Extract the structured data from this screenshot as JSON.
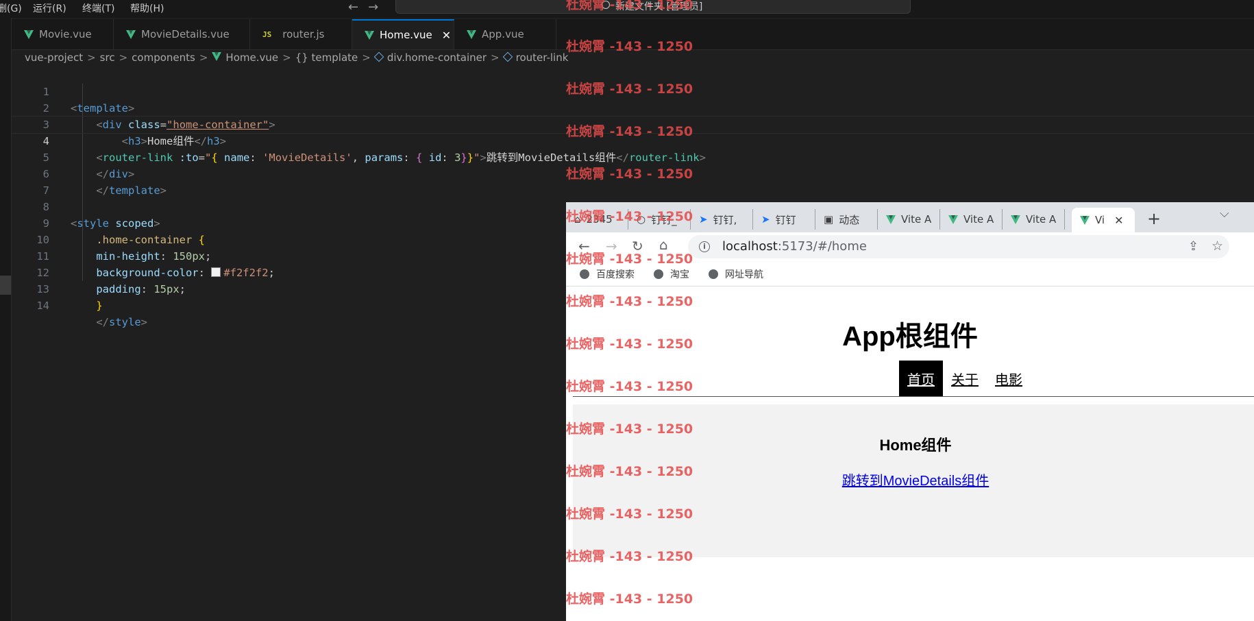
{
  "menubar": {
    "items": [
      "删(G)",
      "运行(R)",
      "终端(T)",
      "帮助(H)"
    ],
    "nav_back": "←",
    "nav_forward": "→",
    "command_center": "新建文件夹 [管理员]"
  },
  "tabs": [
    {
      "label": "Movie.vue",
      "icon": "vue-icon"
    },
    {
      "label": "MovieDetails.vue",
      "icon": "vue-icon"
    },
    {
      "label": "router.js",
      "icon": "js-icon"
    },
    {
      "label": "Home.vue",
      "icon": "vue-icon",
      "active": true
    },
    {
      "label": "App.vue",
      "icon": "vue-icon"
    }
  ],
  "tab_close": "✕",
  "js_badge": "JS",
  "breadcrumb": [
    "vue-project",
    "src",
    "components",
    "Home.vue",
    "{} template",
    "div.home-container",
    "router-link"
  ],
  "breadcrumb_sep": ">",
  "line_numbers": [
    "1",
    "2",
    "3",
    "4",
    "5",
    "6",
    "7",
    "8",
    "9",
    "10",
    "11",
    "12",
    "13",
    "14"
  ],
  "code": {
    "l1_tag": "template",
    "l2_tag": "div",
    "l2_attr": "class",
    "l2_val": "\"home-container\"",
    "l3_tag": "h3",
    "l3_text": "Home组件",
    "l4_tag": "router-link",
    "l4_attr": ":to",
    "l4_name_key": "name",
    "l4_name_val": "'MovieDetails'",
    "l4_params_key": "params",
    "l4_id_key": "id",
    "l4_id_val": "3",
    "l4_text": "跳转到MovieDetails组件",
    "l5_tag": "div",
    "l6_tag": "template",
    "l8_tag": "style",
    "l8_attr": "scoped",
    "l9_sel": ".home-container",
    "l10_prop": "min-height",
    "l10_val": "150px",
    "l11_prop": "background-color",
    "l11_val": "#f2f2f2",
    "l12_prop": "padding",
    "l12_val": "15px",
    "l14_tag": "style"
  },
  "browser": {
    "tabs": [
      "2345",
      "钉钉_",
      "钉钉,",
      "钉钉",
      "动态",
      "Vite A",
      "Vite A",
      "Vite A",
      "Vi"
    ],
    "new_tab": "+",
    "dropdown": "⌵",
    "url_host": "localhost",
    "url_path": ":5173/#/home",
    "bookmarks": [
      "百度搜索",
      "淘宝",
      "网址导航"
    ],
    "page": {
      "title": "App根组件",
      "nav": [
        {
          "label": "首页",
          "active": true
        },
        {
          "label": "关于",
          "active": false
        },
        {
          "label": "电影",
          "active": false
        }
      ],
      "home_title": "Home组件",
      "home_link": "跳转到MovieDetails组件"
    }
  },
  "watermark": "杜婉霄 -143 - 1250",
  "colors": {
    "accent": "#0078d4",
    "vue_green": "#41b883",
    "watermark": "#e64b4b",
    "home_bg": "#f2f2f2"
  }
}
